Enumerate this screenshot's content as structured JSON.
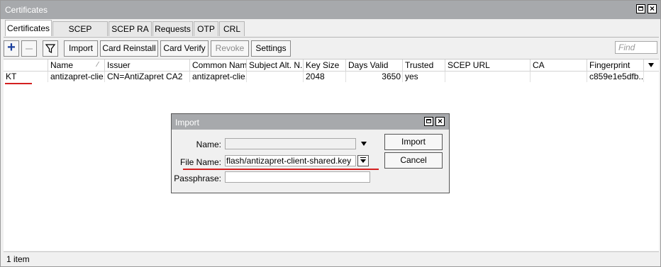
{
  "window": {
    "title": "Certificates"
  },
  "tabs": [
    "Certificates",
    "SCEP Servers",
    "SCEP RA",
    "Requests",
    "OTP",
    "CRL"
  ],
  "toolbar": {
    "import_label": "Import",
    "card_reinstall_label": "Card Reinstall",
    "card_verify_label": "Card Verify",
    "revoke_label": "Revoke",
    "settings_label": "Settings",
    "find_placeholder": "Find"
  },
  "table": {
    "columns": [
      "Name",
      "Issuer",
      "Common Name",
      "Subject Alt. N...",
      "Key Size",
      "Days Valid",
      "Trusted",
      "SCEP URL",
      "CA",
      "Fingerprint"
    ],
    "rows": [
      {
        "flags": "KT",
        "name": "antizapret-clie...",
        "issuer": "CN=AntiZapret CA2",
        "common_name": "antizapret-clie...",
        "subject_alt": "",
        "key_size": "2048",
        "days_valid": "3650",
        "trusted": "yes",
        "scep_url": "",
        "ca": "",
        "fingerprint": "c859e1e5dfb..."
      }
    ]
  },
  "status": {
    "items": "1 item"
  },
  "dialog": {
    "title": "Import",
    "name_label": "Name:",
    "name_value": "",
    "file_label": "File Name:",
    "file_value": "flash/antizapret-client-shared.key",
    "pass_label": "Passphrase:",
    "pass_value": "",
    "import_label": "Import",
    "cancel_label": "Cancel"
  },
  "colors": {
    "titlebar": "#a7a9ac",
    "annotation_red": "#d42020",
    "add_icon": "#1b3f9c"
  }
}
